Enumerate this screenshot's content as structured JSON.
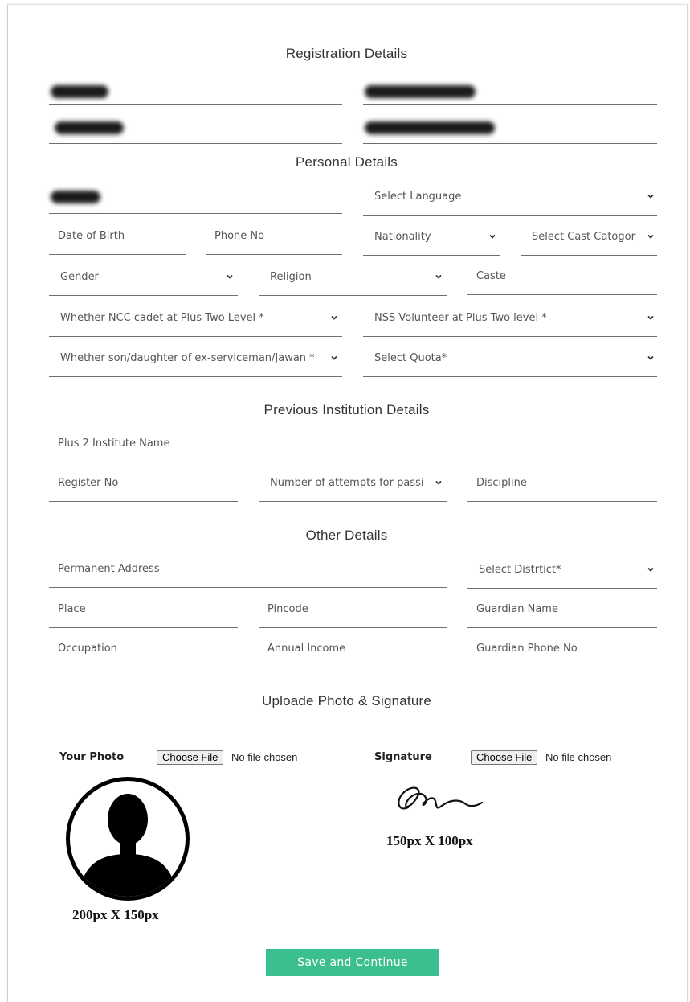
{
  "sections": {
    "registration": "Registration Details",
    "personal": "Personal Details",
    "previous": "Previous Institution Details",
    "other": "Other Details",
    "upload": "Uploade Photo & Signature"
  },
  "personal": {
    "language": "Select Language",
    "dob": "Date of Birth",
    "phone": "Phone No",
    "nationality": "Nationality",
    "cast_category": "Select Cast Catogory",
    "gender": "Gender",
    "religion": "Religion",
    "caste": "Caste",
    "ncc": "Whether NCC cadet at Plus Two Level *",
    "nss": "NSS Volunteer at Plus Two level *",
    "exservice": "Whether son/daughter of ex-serviceman/Jawan *",
    "quota": "Select Quota*"
  },
  "previous": {
    "institute": "Plus 2 Institute Name",
    "register_no": "Register No",
    "attempts": "Number of attempts for passi",
    "discipline": "Discipline"
  },
  "other": {
    "address": "Permanent Address",
    "district": "Select Distrtict*",
    "place": "Place",
    "pincode": "Pincode",
    "guardian_name": "Guardian Name",
    "occupation": "Occupation",
    "income": "Annual Income",
    "guardian_phone": "Guardian Phone No"
  },
  "upload": {
    "photo_label": "Your Photo",
    "signature_label": "Signature",
    "choose_file": "Choose File",
    "no_file": "No file chosen",
    "photo_size": "200px X 150px",
    "signature_size": "150px X 100px"
  },
  "submit": "Save and Continue"
}
